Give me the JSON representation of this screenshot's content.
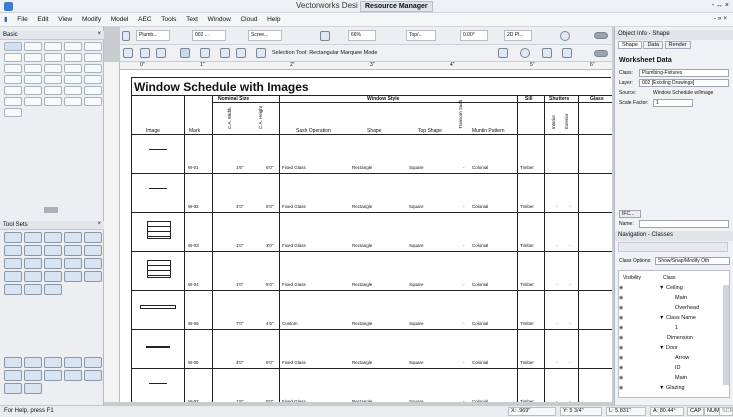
{
  "window": {
    "title": "Vectorworks Desi",
    "overlay_title": "Resource Manager",
    "controls": "- ↔ ×",
    "doc_controls": "- » ×"
  },
  "menu": [
    "File",
    "Edit",
    "View",
    "Modify",
    "Model",
    "AEC",
    "Tools",
    "Text",
    "Window",
    "Cloud",
    "Help"
  ],
  "toolbar": {
    "plumb": "Plumb...",
    "layer_num": "002 ...",
    "screen": "Scree...",
    "zoom": "66%",
    "top": "Top/...",
    "angle": "0.00°",
    "render": "2D Pl...",
    "mode_text": "Selection Tool: Rectangular Marquee Mode"
  },
  "left": {
    "basic_title": "Basic",
    "toolsets_title": "Tool Sets",
    "close": "×"
  },
  "ruler_ticks_h": [
    "0\"",
    "1\"",
    "2\"",
    "3\"",
    "4\"",
    "5\"",
    "6\""
  ],
  "schedule": {
    "title": "Window Schedule with Images",
    "group_headers": {
      "nominal": "Nominal Size",
      "style": "Window Style",
      "sill": "Sill",
      "shutters": "Shutters",
      "glass": "Glass"
    },
    "col_headers": {
      "image": "Image",
      "mark": "Mark",
      "width": "C.A. Width",
      "height": "C.A. Height",
      "sash": "Sash Operation",
      "shape": "Shape",
      "top": "Top Shape",
      "transom": "Transom Sash",
      "muntin": "Muntin Pattern",
      "interior": "Interior",
      "exterior": "Exterior"
    },
    "rows": [
      {
        "mark": "W-01",
        "w": "1'6\"",
        "h": "5'0\"",
        "sash": "Fixed Glass",
        "shape": "Rectangle",
        "top": "Square",
        "transom": "-",
        "muntin": "Colonial",
        "sill": "Timber",
        "int": "",
        "ext": ""
      },
      {
        "mark": "W-02",
        "w": "4'0\"",
        "h": "5'0\"",
        "sash": "Fixed Glass",
        "shape": "Rectangle",
        "top": "Square",
        "transom": "-",
        "muntin": "Colonial",
        "sill": "Timber",
        "int": "-",
        "ext": "-"
      },
      {
        "mark": "W-03",
        "w": "1'0\"",
        "h": "3'0\"",
        "sash": "Fixed Glass",
        "shape": "Rectangle",
        "top": "Square",
        "transom": "-",
        "muntin": "Colonial",
        "sill": "Timber",
        "int": "-",
        "ext": "-"
      },
      {
        "mark": "W-04",
        "w": "1'0\"",
        "h": "5'0\"",
        "sash": "Fixed Glass",
        "shape": "Rectangle",
        "top": "Square",
        "transom": "-",
        "muntin": "Colonial",
        "sill": "Timber",
        "int": "-",
        "ext": "-"
      },
      {
        "mark": "W-05",
        "w": "7'0\"",
        "h": "4'6\"",
        "sash": "Custom",
        "shape": "Rectangle",
        "top": "Square",
        "transom": "-",
        "muntin": "Colonial",
        "sill": "Timber",
        "int": "-",
        "ext": "-"
      },
      {
        "mark": "W-06",
        "w": "4'0\"",
        "h": "5'0\"",
        "sash": "Fixed Glass",
        "shape": "Rectangle",
        "top": "Square",
        "transom": "-",
        "muntin": "Colonial",
        "sill": "Timber",
        "int": "-",
        "ext": "-"
      },
      {
        "mark": "W-07",
        "w": "1'6\"",
        "h": "5'0\"",
        "sash": "Fixed Glass",
        "shape": "Rectangle",
        "top": "Square",
        "transom": "-",
        "muntin": "Colonial",
        "sill": "Timber",
        "int": "-",
        "ext": "-"
      }
    ]
  },
  "obj_info": {
    "title": "Object Info - Shape",
    "tabs": [
      "Shape",
      "Data",
      "Render"
    ],
    "ws_title": "Worksheet Data",
    "class_label": "Class:",
    "class_value": "Plumbing-Fixtures",
    "layer_label": "Layer:",
    "layer_value": "002 [Existing Drawings]",
    "source_label": "Source:",
    "source_value": "Window Schedule w/Image",
    "scale_label": "Scale Factor:",
    "scale_value": "1",
    "ifc": "IFC...",
    "name_label": "Name:"
  },
  "nav": {
    "title": "Navigation - Classes",
    "options_label": "Class Options:",
    "options_value": "Show/Snap/Modify Oth",
    "col_vis": "Visibility",
    "col_class": "Class",
    "items": [
      {
        "label": "▼ Ceiling",
        "indent": 0
      },
      {
        "label": "Main",
        "indent": 2
      },
      {
        "label": "Overhead",
        "indent": 2
      },
      {
        "label": "▼ Class Name",
        "indent": 0
      },
      {
        "label": "1",
        "indent": 2
      },
      {
        "label": "Dimension",
        "indent": 1
      },
      {
        "label": "▼ Door",
        "indent": 0
      },
      {
        "label": "Arrow",
        "indent": 2
      },
      {
        "label": "ID",
        "indent": 2
      },
      {
        "label": "Main",
        "indent": 2
      },
      {
        "label": "▼ Glazing",
        "indent": 0
      }
    ]
  },
  "status": {
    "help": "For Help, press F1",
    "x": "X: .969\"",
    "y": "Y: 5 3/4\"",
    "l": "L: 5.831\"",
    "a": "A: 80.44°",
    "caps": "CAP",
    "num": "NUM",
    "scrl": "SCRL"
  }
}
